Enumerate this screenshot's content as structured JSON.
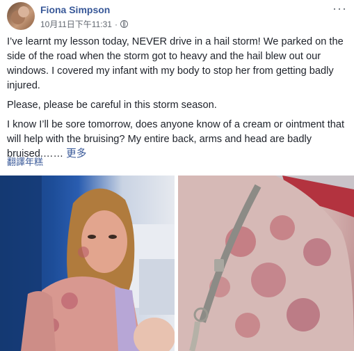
{
  "post": {
    "author": "Fiona Simpson",
    "timestamp": "10月11日下午11:31",
    "separator": "·",
    "more_menu": "···",
    "paragraphs": [
      "I’ve learnt my lesson today, NEVER drive in a hail storm! We parked on the side of the road when the storm got to heavy and the hail blew out our windows. I covered my infant with my body to stop her from getting badly injured.",
      "Please, please be careful in this storm season."
    ],
    "last_paragraph": "I know I’ll be sore tomorrow, does anyone know of a cream or ointment that will help with the bruising? My entire back, arms and head are badly bruised.……",
    "see_more": "更多",
    "translate": "翻譯年糕"
  },
  "colors": {
    "link": "#385898",
    "text": "#1d2129",
    "meta": "#616770"
  }
}
